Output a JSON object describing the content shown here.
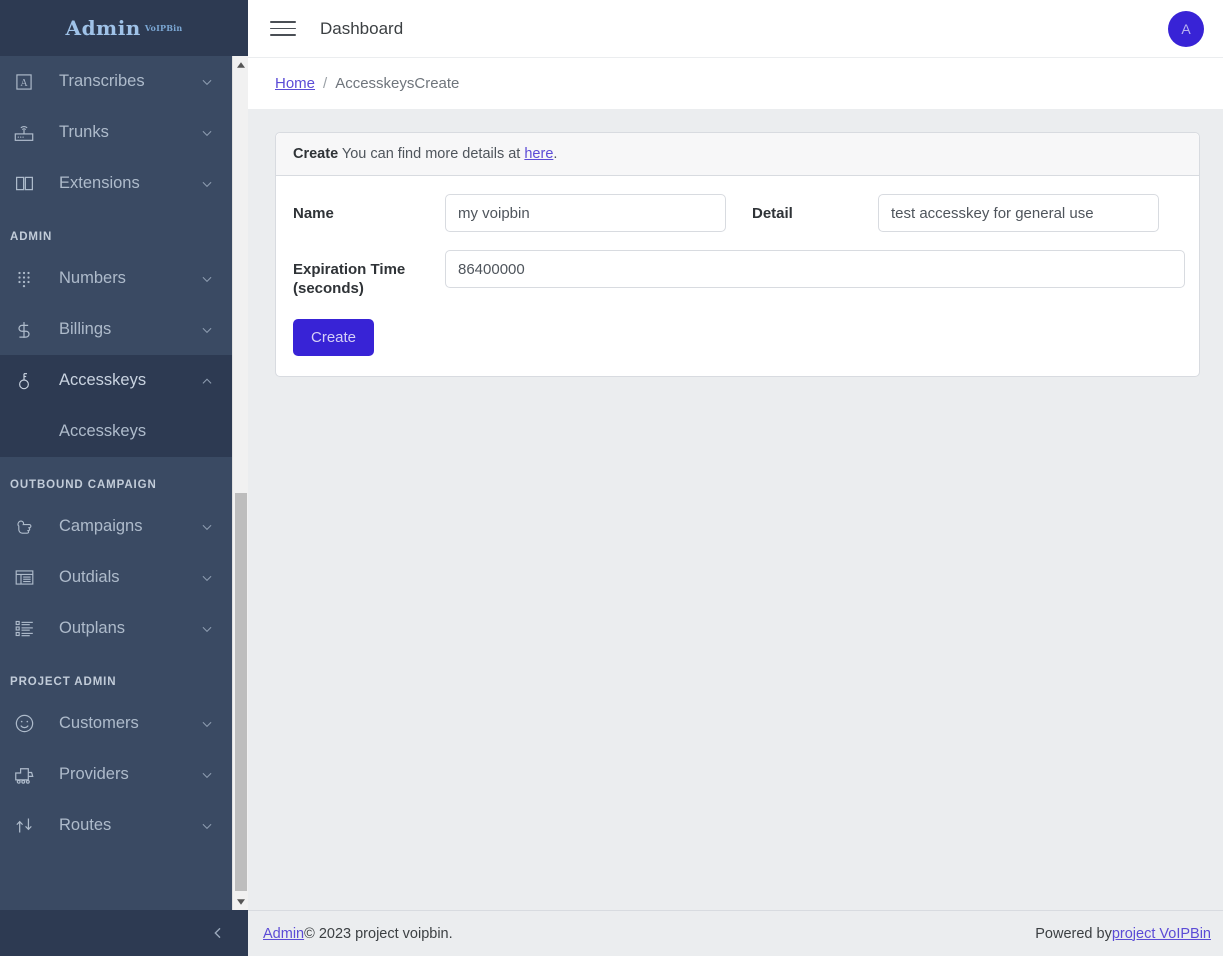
{
  "sidebar": {
    "brand": {
      "name": "Admin",
      "superscript": "VoIPBin"
    },
    "groups": [
      {
        "label": null,
        "items": [
          {
            "label": "Transcribes",
            "icon": "letter-a-box-icon",
            "chevron": "down",
            "active": false
          },
          {
            "label": "Trunks",
            "icon": "router-wifi-icon",
            "chevron": "down",
            "active": false
          },
          {
            "label": "Extensions",
            "icon": "open-book-icon",
            "chevron": "down",
            "active": false
          }
        ]
      },
      {
        "label": "ADMIN",
        "items": [
          {
            "label": "Numbers",
            "icon": "dialpad-icon",
            "chevron": "down",
            "active": false
          },
          {
            "label": "Billings",
            "icon": "dollar-icon",
            "chevron": "down",
            "active": false
          },
          {
            "label": "Accesskeys",
            "icon": "key-icon",
            "chevron": "up",
            "active": true,
            "children": [
              {
                "label": "Accesskeys"
              }
            ]
          }
        ]
      },
      {
        "label": "OUTBOUND CAMPAIGN",
        "items": [
          {
            "label": "Campaigns",
            "icon": "pointing-hand-icon",
            "chevron": "down",
            "active": false
          },
          {
            "label": "Outdials",
            "icon": "table-list-icon",
            "chevron": "down",
            "active": false
          },
          {
            "label": "Outplans",
            "icon": "ordered-list-icon",
            "chevron": "down",
            "active": false
          }
        ]
      },
      {
        "label": "PROJECT ADMIN",
        "items": [
          {
            "label": "Customers",
            "icon": "smiley-face-icon",
            "chevron": "down",
            "active": false
          },
          {
            "label": "Providers",
            "icon": "train-icon",
            "chevron": "down",
            "active": false
          },
          {
            "label": "Routes",
            "icon": "arrows-route-icon",
            "chevron": "down",
            "active": false
          }
        ]
      }
    ],
    "collapse_icon": "chevron-left-icon"
  },
  "topbar": {
    "menu_icon": "hamburger-icon",
    "title": "Dashboard",
    "avatar_initial": "A"
  },
  "breadcrumb": {
    "home": "Home",
    "separator": "/",
    "current": "AccesskeysCreate"
  },
  "card": {
    "header": {
      "title": "Create",
      "text": " You can find more details at ",
      "link": "here",
      "period": "."
    },
    "fields": [
      {
        "label": "Name",
        "value": "my voipbin",
        "name": "name-input"
      },
      {
        "label": "Detail",
        "value": "test accesskey for general use",
        "name": "detail-input"
      },
      {
        "label": "Expiration Time (seconds)",
        "value": "86400000",
        "name": "expiration-time-input"
      }
    ],
    "submit_label": "Create"
  },
  "footer": {
    "link": "Admin",
    "copyright": " © 2023 project voipbin.",
    "powered_by": "Powered by ",
    "powered_link": "project VoIPBin"
  },
  "colors": {
    "sidebar_bg": "#3a4a63",
    "sidebar_active_bg": "#2d3a52",
    "accent": "#3823d6",
    "link": "#5b4bd6",
    "content_bg": "#ebedef"
  }
}
